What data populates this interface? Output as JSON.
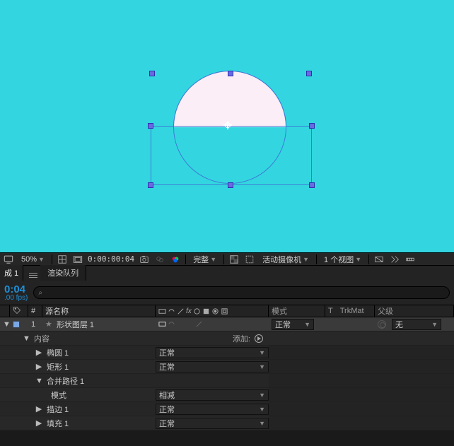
{
  "viewport": {
    "zoom": "50%",
    "timecode_bar": "0:00:00:04",
    "resolution": "完整",
    "camera": "活动摄像机",
    "views": "1 个视图"
  },
  "tabs": {
    "comp_tab_fragment": "成 1",
    "render_queue": "渲染队列"
  },
  "timeline": {
    "timecode": "0:04",
    "fps": ".00 fps)"
  },
  "search": {
    "placeholder": ""
  },
  "columns": {
    "hash": "#",
    "source_name": "源名称",
    "mode": "模式",
    "trkmat_t": "T",
    "trkmat": "TrkMat",
    "parent": "父级"
  },
  "layer": {
    "index": "1",
    "name": "形状图层 1",
    "mode": "正常",
    "parent": "无"
  },
  "contents_header": "内容",
  "add_label": "添加:",
  "props": {
    "ellipse": "椭圆 1",
    "rect": "矩形 1",
    "merge": "合并路径 1",
    "merge_mode_label": "模式",
    "stroke": "描边 1",
    "fill": "填充 1"
  },
  "modes": {
    "normal": "正常",
    "subtract": "相减"
  }
}
